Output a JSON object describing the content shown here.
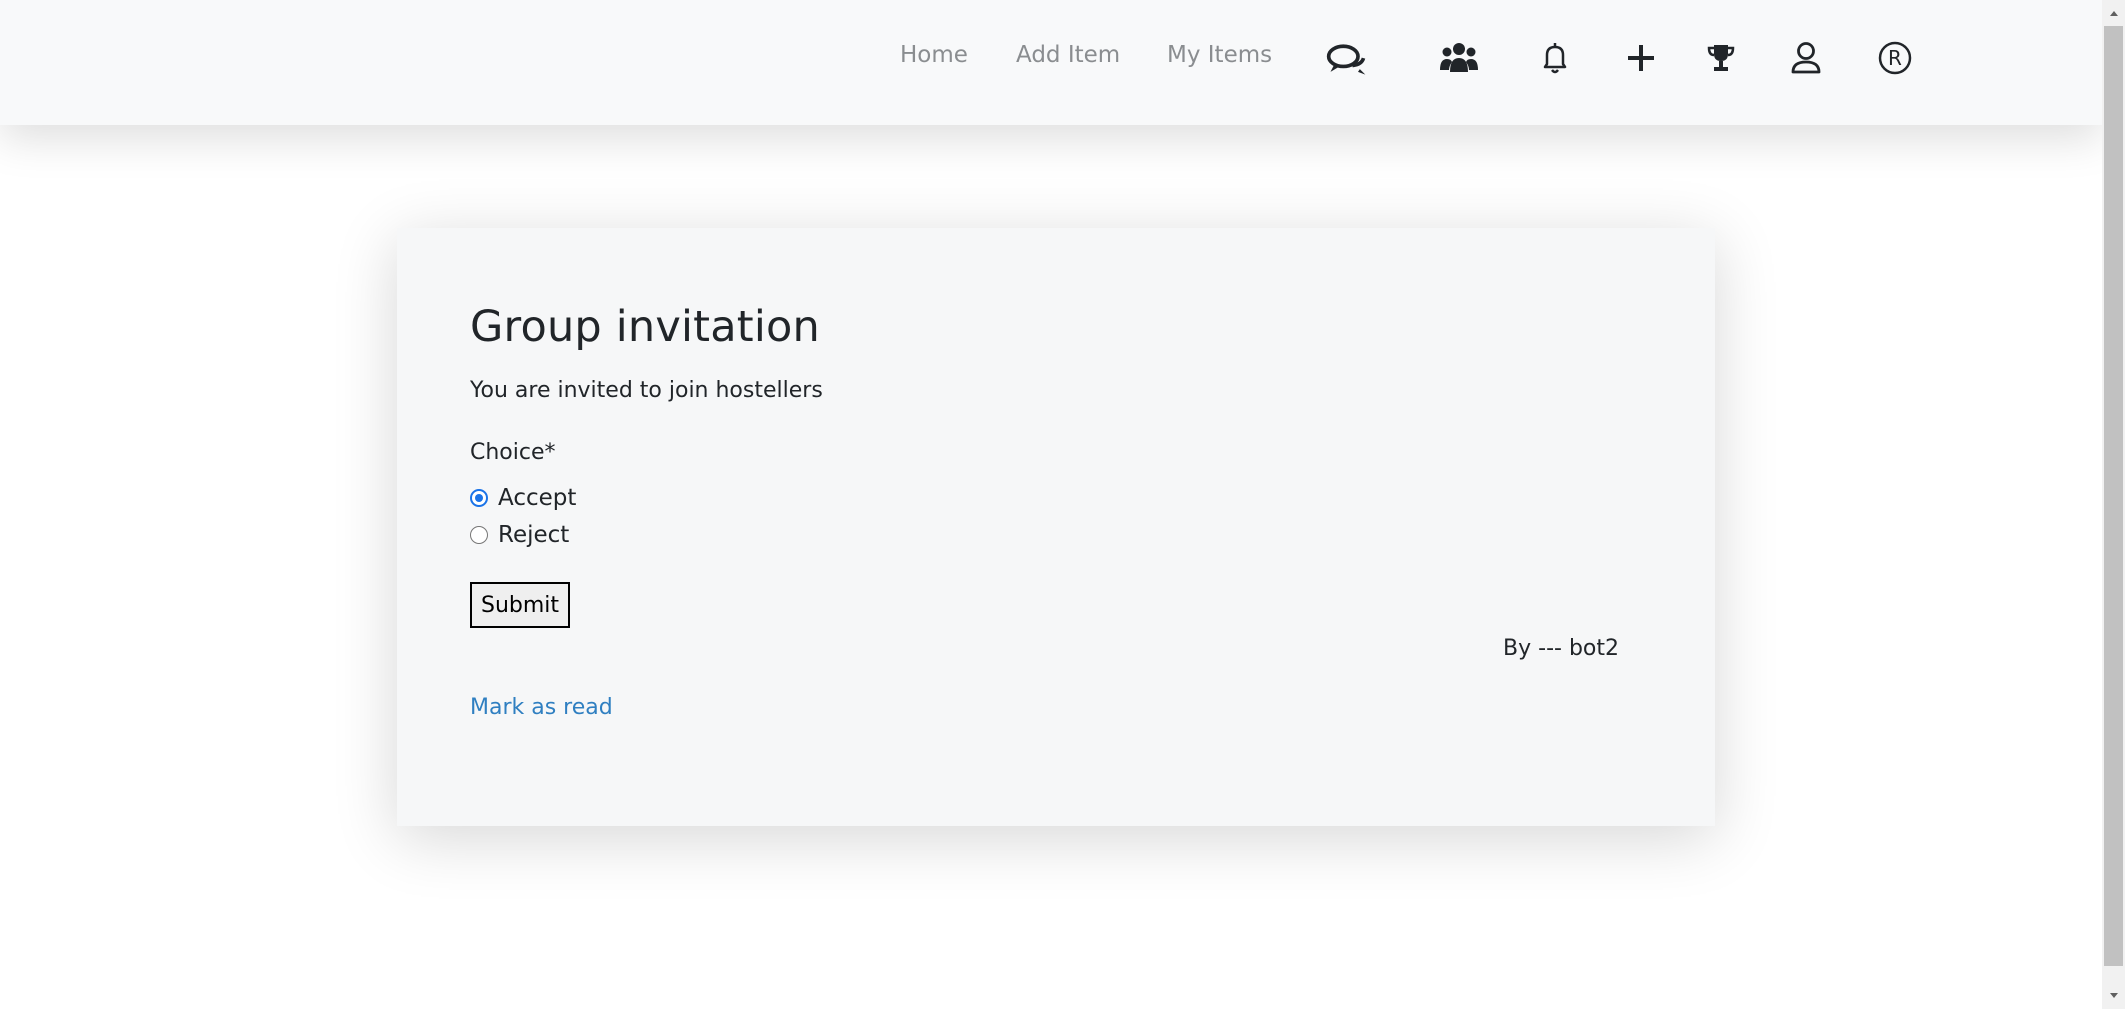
{
  "navbar": {
    "links": [
      {
        "label": "Home"
      },
      {
        "label": "Add Item"
      },
      {
        "label": "My Items"
      }
    ],
    "icons": [
      "chat-icon",
      "group-icon",
      "bell-icon",
      "plus-icon",
      "trophy-icon",
      "user-icon",
      "registered-icon"
    ]
  },
  "card": {
    "title": "Group invitation",
    "text": "You are invited to join hostellers",
    "choice_label": "Choice*",
    "options": [
      {
        "label": "Accept",
        "checked": true
      },
      {
        "label": "Reject",
        "checked": false
      }
    ],
    "submit_label": "Submit",
    "by_line": "By --- bot2",
    "mark_read_label": "Mark as read"
  },
  "colors": {
    "navbar_bg": "#f8f9fa",
    "card_bg": "#f6f7f8",
    "link_blue": "#2f7fc1",
    "radio_blue": "#1a73e8",
    "nav_text": "#8a8d90"
  }
}
